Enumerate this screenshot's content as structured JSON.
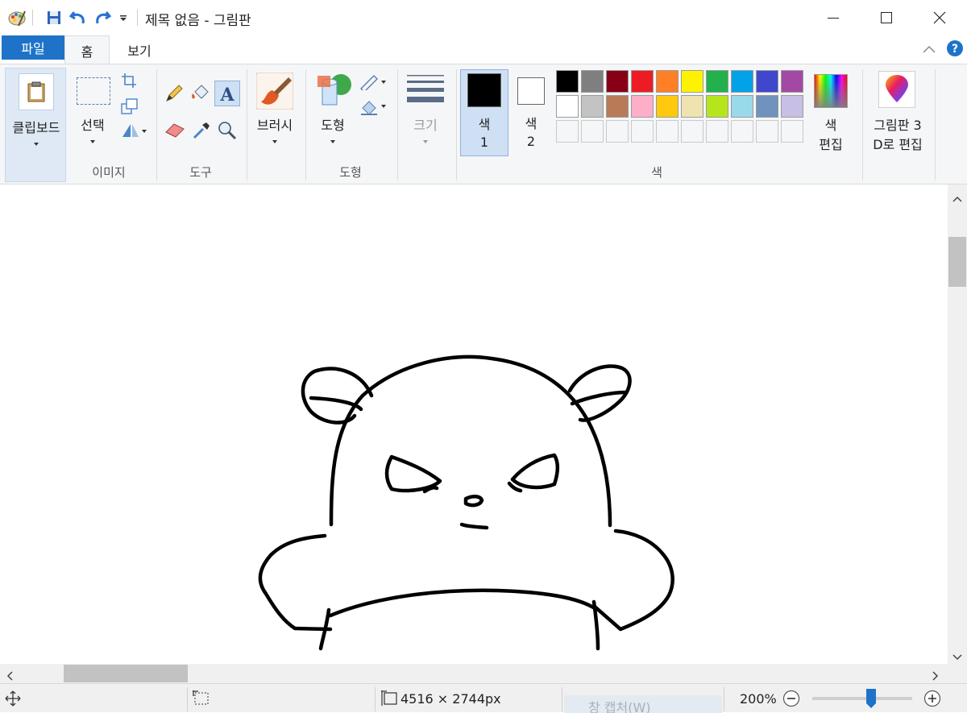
{
  "window": {
    "title": "제목 없음 - 그림판"
  },
  "tabs": {
    "file": "파일",
    "home": "홈",
    "view": "보기"
  },
  "ribbon": {
    "clipboard": "클립보드",
    "select": "선택",
    "image_group": "이미지",
    "tools_group": "도구",
    "brush": "브러시",
    "shapes": "도형",
    "shapes_group": "도형",
    "size": "크기",
    "color1_line1": "색",
    "color1_line2": "1",
    "color2_line1": "색",
    "color2_line2": "2",
    "edit_colors_line1": "색",
    "edit_colors_line2": "편집",
    "colors_group": "색",
    "paint3d_line1": "그림판 3",
    "paint3d_line2": "D로 편집",
    "color1_value": "#000000",
    "color2_value": "#ffffff",
    "palette": [
      "#000000",
      "#7f7f7f",
      "#880015",
      "#ed1c24",
      "#ff7f27",
      "#fff200",
      "#22b14c",
      "#00a2e8",
      "#3f48cc",
      "#a349a4",
      "#ffffff",
      "#c3c3c3",
      "#b97a57",
      "#ffaec9",
      "#ffc90e",
      "#efe4b0",
      "#b5e61d",
      "#99d9ea",
      "#7092be",
      "#c8bfe7"
    ],
    "custom_slots": 10
  },
  "status": {
    "image_size": "4516 × 2744px",
    "zoom": "200%",
    "zoom_fraction": 0.59,
    "ghost_text": "창 캡처(W)"
  },
  "icons": {
    "app": "paint-app-icon",
    "save": "save-icon",
    "undo": "undo-icon",
    "redo": "redo-icon",
    "help": "help-icon"
  }
}
